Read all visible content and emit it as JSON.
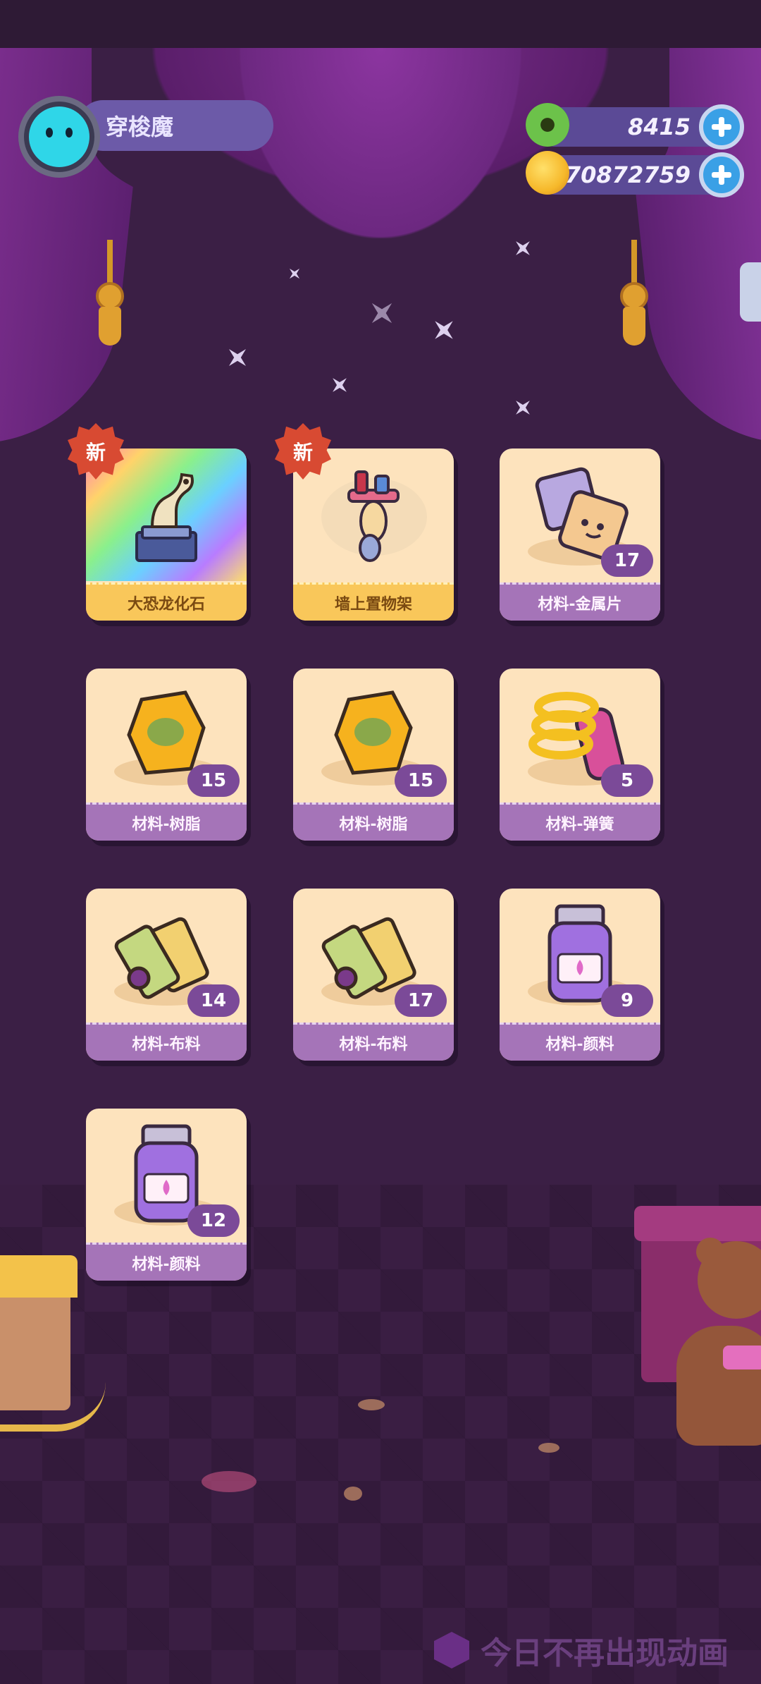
{
  "player": {
    "name": "穿梭魔"
  },
  "currencies": [
    {
      "id": "gem",
      "value": "8415",
      "icon": "green-donut-icon",
      "color": "#6cc24a"
    },
    {
      "id": "coin",
      "value": "70872759",
      "icon": "gold-planet-icon",
      "color": "#f6b82a"
    }
  ],
  "new_badge_text": "新",
  "items": [
    {
      "label": "大恐龙化石",
      "count": null,
      "is_new": true,
      "style": "gold",
      "icon": "dinosaur-fossil-icon"
    },
    {
      "label": "墙上置物架",
      "count": null,
      "is_new": true,
      "style": "gold",
      "icon": "wall-shelf-icon"
    },
    {
      "label": "材料-金属片",
      "count": "17",
      "is_new": false,
      "style": "purple",
      "icon": "metal-sheet-icon"
    },
    {
      "label": "材料-树脂",
      "count": "15",
      "is_new": false,
      "style": "purple",
      "icon": "resin-icon"
    },
    {
      "label": "材料-树脂",
      "count": "15",
      "is_new": false,
      "style": "purple",
      "icon": "resin-icon"
    },
    {
      "label": "材料-弹簧",
      "count": "5",
      "is_new": false,
      "style": "purple",
      "icon": "spring-icon"
    },
    {
      "label": "材料-布料",
      "count": "14",
      "is_new": false,
      "style": "purple",
      "icon": "fabric-roll-icon"
    },
    {
      "label": "材料-布料",
      "count": "17",
      "is_new": false,
      "style": "purple",
      "icon": "fabric-roll-icon"
    },
    {
      "label": "材料-颜料",
      "count": "9",
      "is_new": false,
      "style": "purple",
      "icon": "paint-jar-icon"
    },
    {
      "label": "材料-颜料",
      "count": "12",
      "is_new": false,
      "style": "purple",
      "icon": "paint-jar-icon"
    }
  ],
  "footer": {
    "toggle_label": "今日不再出现动画",
    "icon": "hexagon-checkbox-icon"
  }
}
